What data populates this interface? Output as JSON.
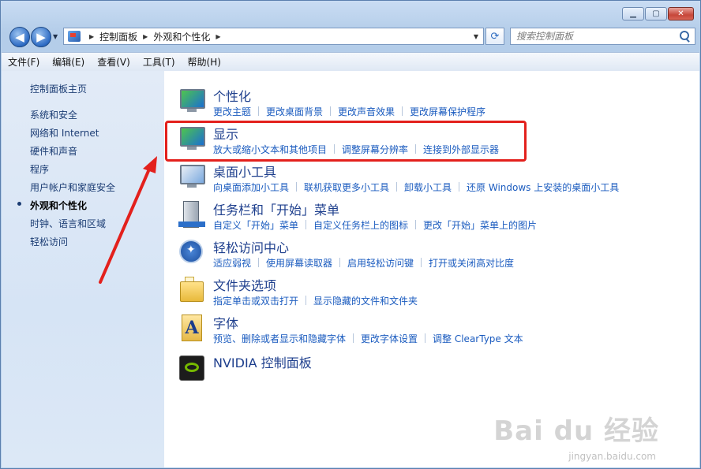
{
  "window": {
    "caption_buttons": [
      "minimize",
      "maximize",
      "close"
    ]
  },
  "address": {
    "crumbs": [
      "控制面板",
      "外观和个性化"
    ]
  },
  "search": {
    "placeholder": "搜索控制面板"
  },
  "menu": [
    {
      "label": "文件(F)"
    },
    {
      "label": "编辑(E)"
    },
    {
      "label": "查看(V)"
    },
    {
      "label": "工具(T)"
    },
    {
      "label": "帮助(H)"
    }
  ],
  "sidebar": {
    "home": "控制面板主页",
    "items": [
      {
        "label": "系统和安全"
      },
      {
        "label": "网络和 Internet"
      },
      {
        "label": "硬件和声音"
      },
      {
        "label": "程序"
      },
      {
        "label": "用户帐户和家庭安全"
      },
      {
        "label": "外观和个性化"
      },
      {
        "label": "时钟、语言和区域"
      },
      {
        "label": "轻松访问"
      }
    ]
  },
  "categories": [
    {
      "icon": "personalization-icon",
      "title": "个性化",
      "links": [
        "更改主题",
        "更改桌面背景",
        "更改声音效果",
        "更改屏幕保护程序"
      ]
    },
    {
      "icon": "display-icon",
      "title": "显示",
      "links": [
        "放大或缩小文本和其他项目",
        "调整屏幕分辨率",
        "连接到外部显示器"
      ]
    },
    {
      "icon": "gadgets-icon",
      "title": "桌面小工具",
      "links": [
        "向桌面添加小工具",
        "联机获取更多小工具",
        "卸载小工具",
        "还原 Windows 上安装的桌面小工具"
      ]
    },
    {
      "icon": "taskbar-icon",
      "title": "任务栏和「开始」菜单",
      "links": [
        "自定义「开始」菜单",
        "自定义任务栏上的图标",
        "更改「开始」菜单上的图片"
      ]
    },
    {
      "icon": "ease-of-access-icon",
      "title": "轻松访问中心",
      "links": [
        "适应弱视",
        "使用屏幕读取器",
        "启用轻松访问键",
        "打开或关闭高对比度"
      ]
    },
    {
      "icon": "folder-options-icon",
      "title": "文件夹选项",
      "links": [
        "指定单击或双击打开",
        "显示隐藏的文件和文件夹"
      ]
    },
    {
      "icon": "fonts-icon",
      "title": "字体",
      "links": [
        "预览、删除或者显示和隐藏字体",
        "更改字体设置",
        "调整 ClearType 文本"
      ]
    },
    {
      "icon": "nvidia-icon",
      "title": "NVIDIA 控制面板",
      "links": []
    }
  ],
  "watermark": {
    "main": "Bai du 经验",
    "sub": "jingyan.baidu.com"
  },
  "annotation_color": "#e3201c"
}
